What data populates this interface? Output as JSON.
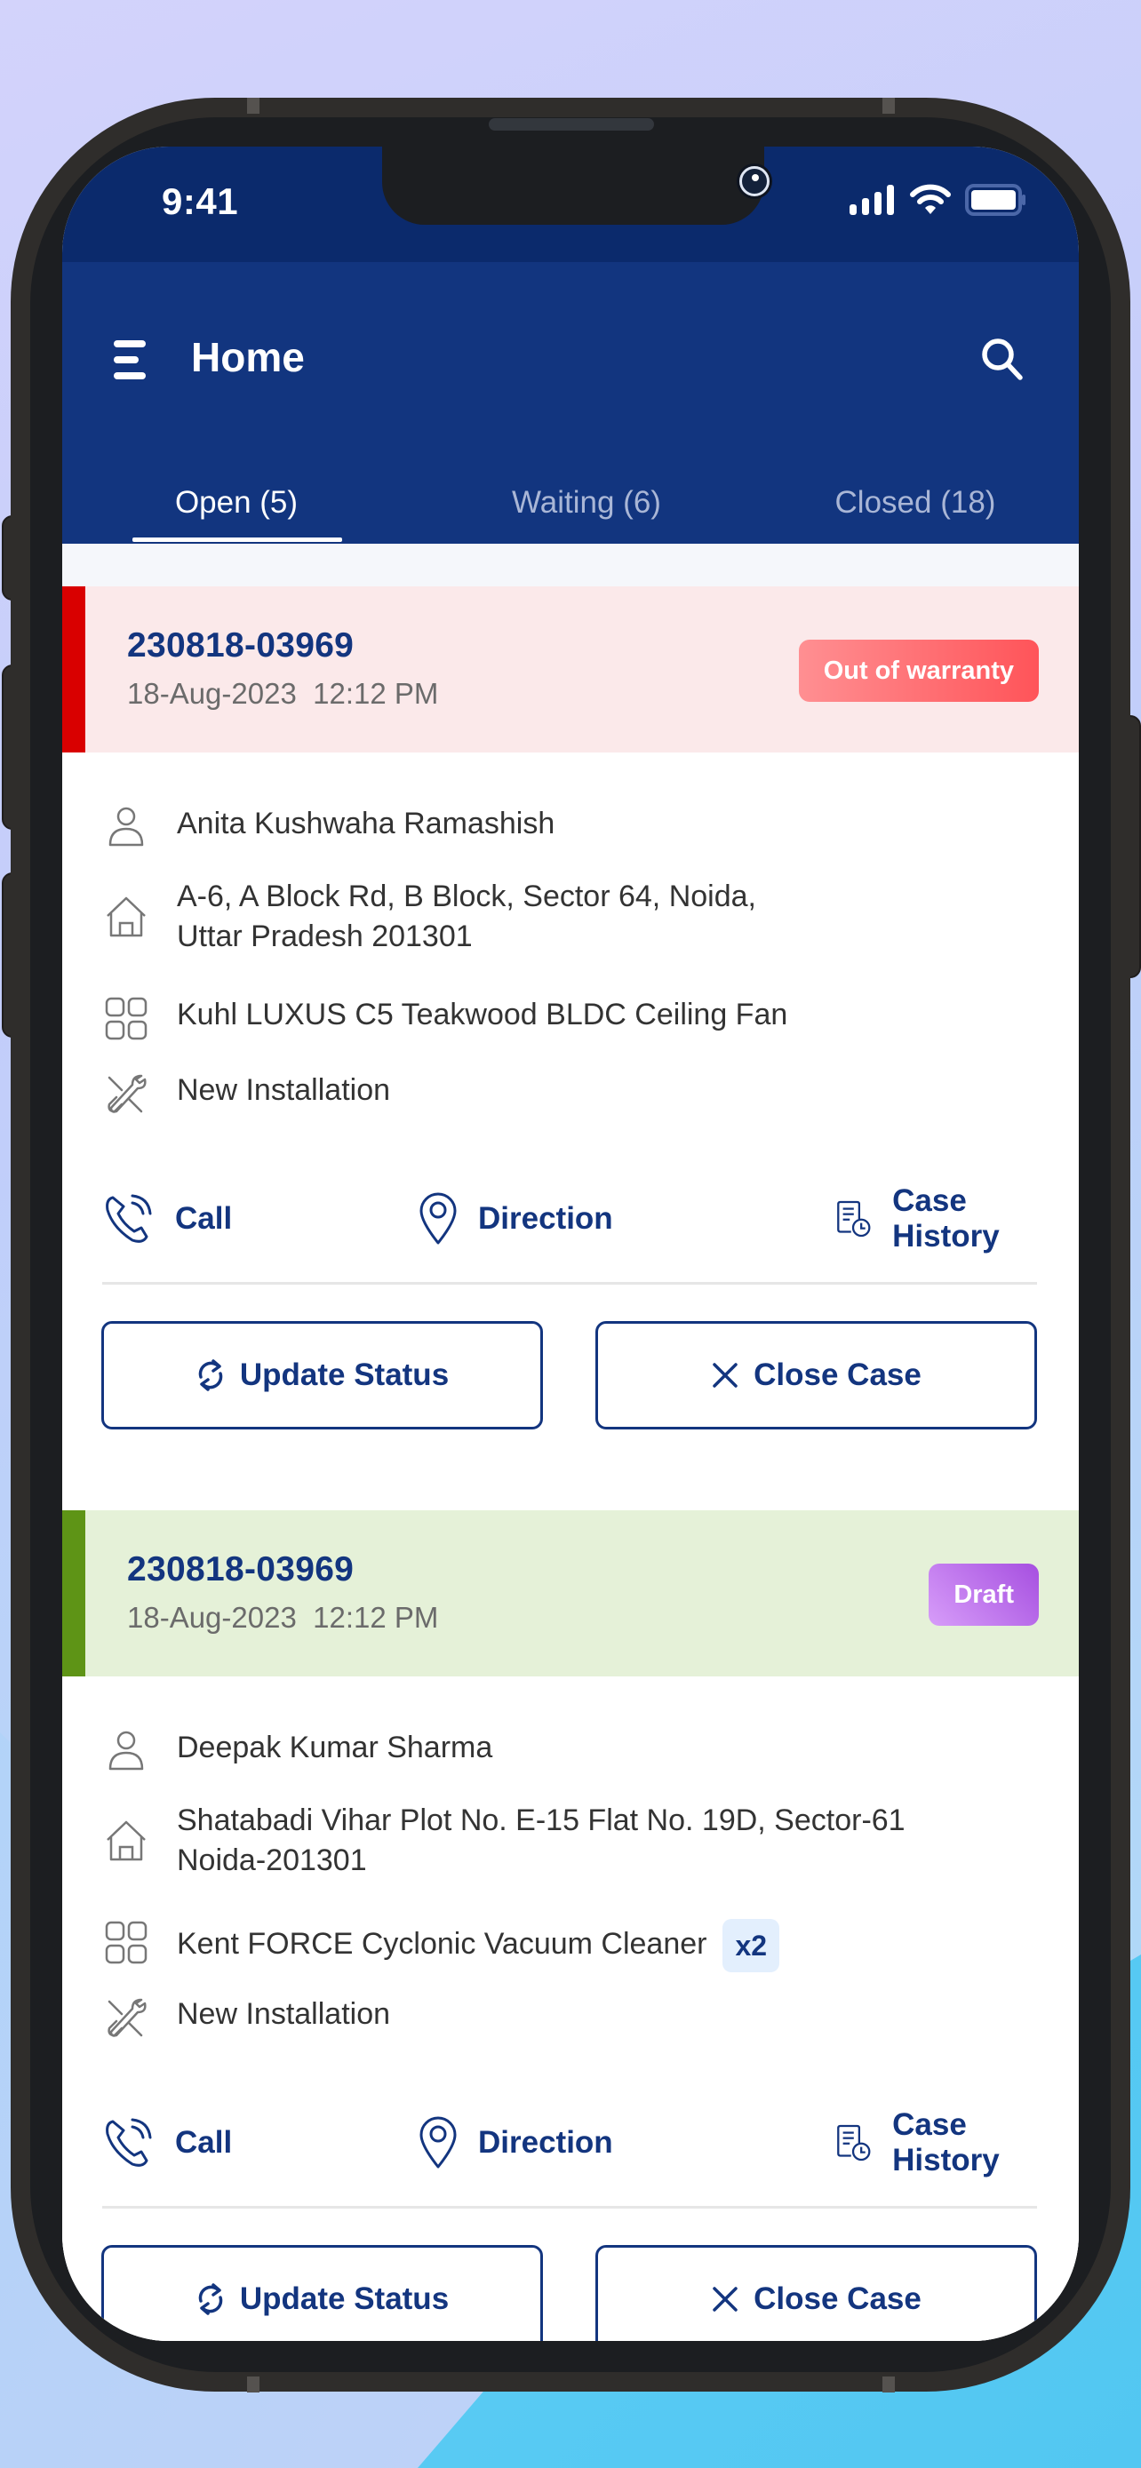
{
  "status_bar": {
    "time": "9:41",
    "icons": [
      "signal-icon",
      "wifi-icon",
      "battery-icon"
    ]
  },
  "header": {
    "title": "Home",
    "menu_icon": "hamburger-menu-icon",
    "search_icon": "search-icon"
  },
  "tabs": [
    {
      "label": "Open (5)",
      "active": true
    },
    {
      "label": "Waiting (6)",
      "active": false
    },
    {
      "label": "Closed (18)",
      "active": false
    }
  ],
  "cases": [
    {
      "id": "230818-03969",
      "date": "18-Aug-2023  12:12 PM",
      "badge": "Out of warranty",
      "accent_color": "#d90000",
      "header_bg": "#fbe9ea",
      "badge_color": "#ff5a5f",
      "customer": "Anita Kushwaha Ramashish",
      "address_line1": "A-6, A Block Rd, B Block, Sector 64, Noida,",
      "address_line2": "Uttar Pradesh 201301",
      "product": "Kuhl LUXUS C5 Teakwood BLDC Ceiling Fan",
      "quantity": null,
      "service_type": "New Installation",
      "actions": {
        "call": "Call",
        "direction": "Direction",
        "history": "Case History"
      },
      "buttons": {
        "update": "Update Status",
        "close": "Close Case"
      }
    },
    {
      "id": "230818-03969",
      "date": "18-Aug-2023  12:12 PM",
      "badge": "Draft",
      "accent_color": "#5e9416",
      "header_bg": "#e5f1d8",
      "badge_color": "#b46af0",
      "customer": "Deepak Kumar Sharma",
      "address_line1": "Shatabadi Vihar Plot No. E-15 Flat No. 19D, Sector-61",
      "address_line2": "Noida-201301",
      "product": "Kent FORCE Cyclonic Vacuum Cleaner",
      "quantity": "x2",
      "service_type": "New Installation",
      "actions": {
        "call": "Call",
        "direction": "Direction",
        "history": "Case History"
      },
      "buttons": {
        "update": "Update Status",
        "close": "Close Case"
      }
    }
  ],
  "colors": {
    "primary": "#13357f",
    "status_bar": "#0b2a6c",
    "header": "#12357f"
  }
}
